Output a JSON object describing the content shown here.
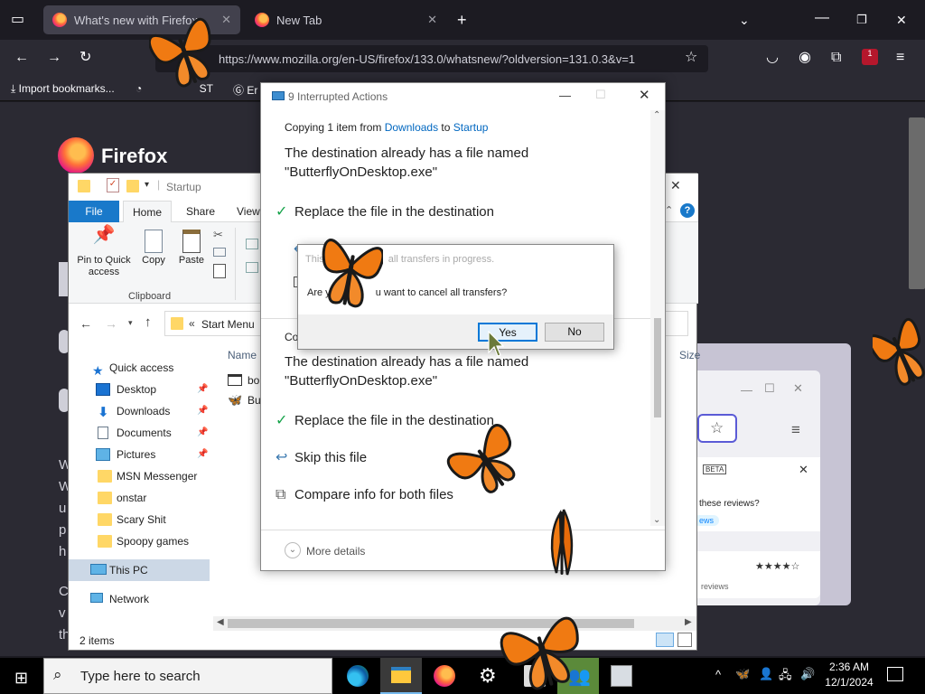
{
  "firefox": {
    "tabs": [
      {
        "label": "What's new with Firefox",
        "active": true
      },
      {
        "label": "New Tab",
        "active": false
      }
    ],
    "url": "https://www.mozilla.org/en-US/firefox/133.0/whatsnew/?oldversion=131.0.3&v=1",
    "extensions_badge": "1",
    "bookmarks": [
      {
        "label": "Import bookmarks..."
      },
      {
        "label": "ST"
      },
      {
        "label": "Er"
      }
    ],
    "page": {
      "logo_text": "Firefox",
      "left_fragments": [
        "W",
        "W",
        "u",
        "p",
        "h",
        "C",
        "v",
        "th"
      ],
      "panel": {
        "title_fragment": "er",
        "beta_badge": "BETA",
        "question_fragment": "these reviews?",
        "link_fragment": "ews",
        "reviews_fragment": "reviews",
        "stars": "★★★★☆"
      }
    }
  },
  "explorer": {
    "title": "Startup",
    "ribbon_tabs": [
      "File",
      "Home",
      "Share",
      "View"
    ],
    "ribbon_buttons": [
      {
        "label": "Pin to Quick access"
      },
      {
        "label": "Copy"
      },
      {
        "label": "Paste"
      }
    ],
    "group_label": "Clipboard",
    "address": "Start Menu",
    "address_sep": "«",
    "column_name": "Name",
    "column_size": "Size",
    "files": [
      {
        "name": "bo"
      },
      {
        "name": "But"
      }
    ],
    "nav": [
      {
        "label": "Quick access",
        "type": "star"
      },
      {
        "label": "Desktop",
        "type": "desktop",
        "pinned": true
      },
      {
        "label": "Downloads",
        "type": "download",
        "pinned": true
      },
      {
        "label": "Documents",
        "type": "doc",
        "pinned": true
      },
      {
        "label": "Pictures",
        "type": "pic",
        "pinned": true
      },
      {
        "label": "MSN Messenger",
        "type": "folder"
      },
      {
        "label": "onstar",
        "type": "folder"
      },
      {
        "label": "Scary Shit",
        "type": "folder"
      },
      {
        "label": "Spoopy games",
        "type": "folder"
      },
      {
        "label": "This PC",
        "type": "pc",
        "selected": true
      },
      {
        "label": "Network",
        "type": "network"
      }
    ],
    "status": "2 items"
  },
  "copy_dialog": {
    "title": "9 Interrupted Actions",
    "copying_prefix": "Copying 1 item from ",
    "source": "Downloads",
    "to_word": " to ",
    "destination": "Startup",
    "conflict_line1": "The destination already has a file named",
    "conflict_line2": "\"ButterflyOnDesktop.exe\"",
    "options": [
      {
        "label": "Replace the file in the destination",
        "icon": "check-icon"
      },
      {
        "label": "Skip this file",
        "icon": "skip-icon"
      },
      {
        "label": "Compare info for both files",
        "icon": "compare-icon"
      }
    ],
    "second_fragment": "Co",
    "more_details": "More details"
  },
  "confirm_dialog": {
    "line1_a": "This w",
    "line1_b": "all transfers in progress.",
    "line2_a": "Are y",
    "line2_b": "u want to cancel all transfers?",
    "yes": "Yes",
    "no": "No"
  },
  "taskbar": {
    "search_placeholder": "Type here to search",
    "time": "2:36 AM",
    "date": "12/1/2024"
  },
  "colors": {
    "accent": "#0067c0",
    "file_tab": "#1979ca",
    "firefox_dark": "#1c1b22",
    "butterfly": "#f07a12"
  }
}
